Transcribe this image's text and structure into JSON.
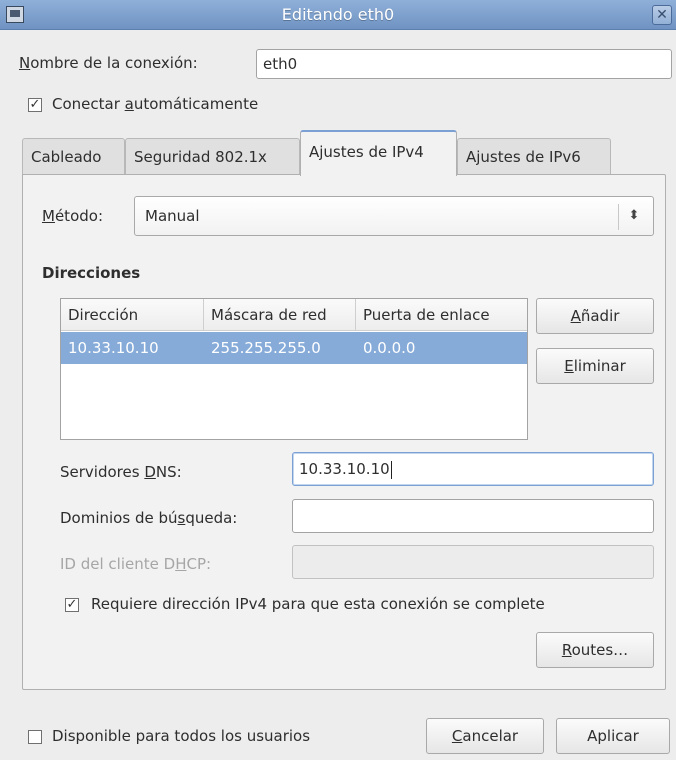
{
  "window": {
    "title": "Editando eth0"
  },
  "connection": {
    "name_label": "Nombre de la conexión:",
    "name_value": "eth0",
    "autoconnect_label": "Conectar automáticamente",
    "autoconnect_checked": true
  },
  "tabs": [
    {
      "label": "Cableado",
      "active": false
    },
    {
      "label": "Seguridad 802.1x",
      "active": false
    },
    {
      "label": "Ajustes de IPv4",
      "active": true
    },
    {
      "label": "Ajustes de IPv6",
      "active": false
    }
  ],
  "ipv4": {
    "method_label": "Método:",
    "method_value": "Manual",
    "addresses_heading": "Direcciones",
    "columns": [
      "Dirección",
      "Máscara de red",
      "Puerta de enlace"
    ],
    "rows": [
      {
        "address": "10.33.10.10",
        "netmask": "255.255.255.0",
        "gateway": "0.0.0.0"
      }
    ],
    "add_label": "Añadir",
    "remove_label": "Eliminar",
    "dns_label": "Servidores DNS:",
    "dns_value": "10.33.10.10",
    "search_label": "Dominios de búsqueda:",
    "search_value": "",
    "dhcp_label": "ID del cliente DHCP:",
    "dhcp_value": "",
    "require_label": "Requiere dirección IPv4 para que esta conexión se complete",
    "require_checked": true,
    "routes_label": "Routes…"
  },
  "footer": {
    "all_users_label": "Disponible para todos los usuarios",
    "all_users_checked": false,
    "cancel_label": "Cancelar",
    "apply_label": "Aplicar"
  },
  "colors": {
    "titlebar": "#7b9ccb",
    "selection": "#86abd9",
    "focus": "#7aa0d4"
  },
  "icons": [
    "window-menu-icon",
    "close-icon",
    "checkbox-checked-icon",
    "checkbox-unchecked-icon",
    "combo-arrows-icon"
  ]
}
